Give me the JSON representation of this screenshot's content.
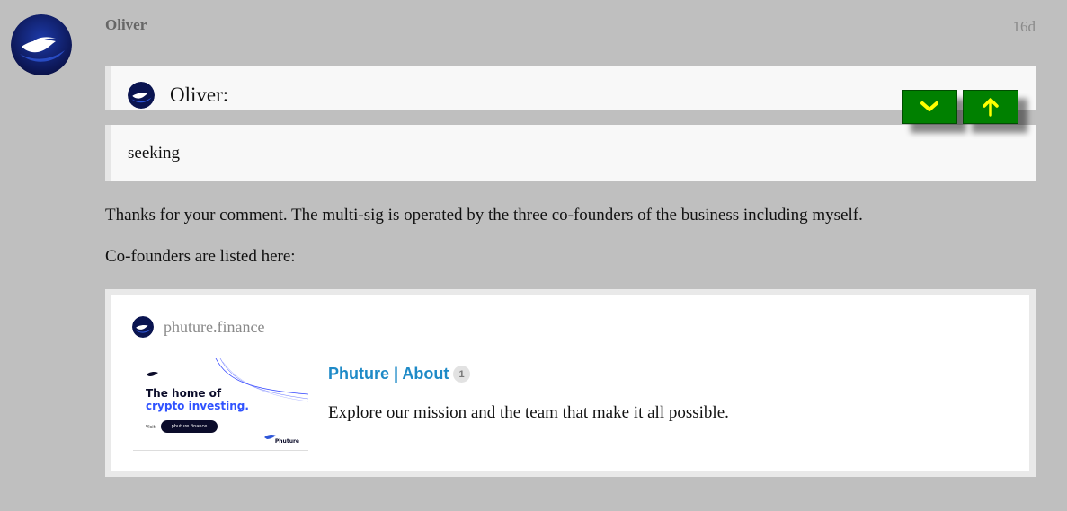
{
  "post": {
    "author": "Oliver",
    "timestamp": "16d",
    "avatar_icon": "phuture-logo-icon"
  },
  "quote": {
    "author": "Oliver:",
    "text": "seeking"
  },
  "nav": {
    "down_icon": "chevron-down-icon",
    "up_icon": "arrow-up-icon",
    "button_color": "#008000",
    "icon_color": "#ffff00"
  },
  "body": {
    "paragraph_1": "Thanks for your comment. The multi-sig is operated by the three co-founders of the business including myself.",
    "paragraph_2": "Co-founders are listed here:"
  },
  "onebox": {
    "site": "phuture.finance",
    "title": "Phuture | About",
    "click_count": "1",
    "description": "Explore our mission and the team that make it all possible.",
    "thumbnail": {
      "headline_1": "The home of",
      "headline_2": "crypto investing.",
      "visit_label": "Visit",
      "pill_text": "phuture.finance",
      "brand": "Phuture"
    },
    "title_color": "#1e8ac7"
  }
}
